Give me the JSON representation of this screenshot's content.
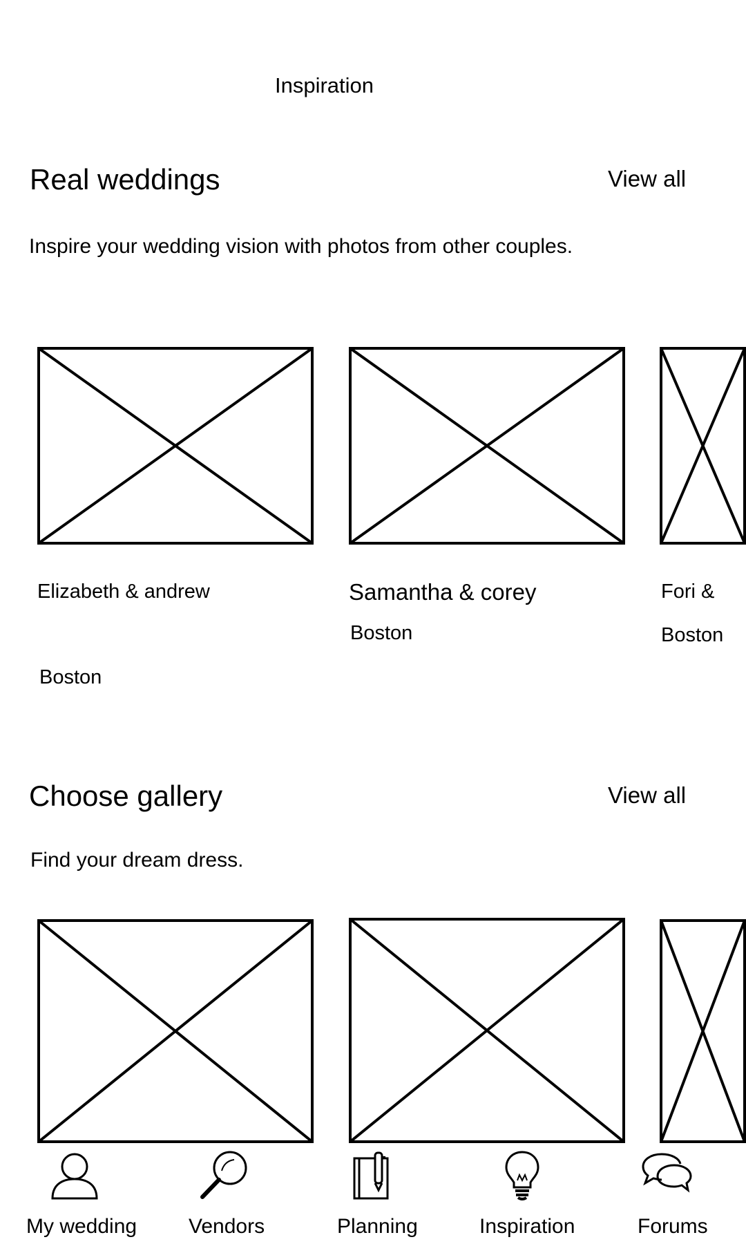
{
  "header": {
    "title": "Inspiration"
  },
  "real_weddings": {
    "title": "Real weddings",
    "view_all": "View all",
    "subtitle": "Inspire your wedding vision with photos from other couples.",
    "cards": [
      {
        "names": "Elizabeth & andrew",
        "location": "Boston"
      },
      {
        "names": "Samantha & corey",
        "location": "Boston"
      },
      {
        "names": "Fori &",
        "location": "Boston"
      }
    ]
  },
  "choose_gallery": {
    "title": "Choose gallery",
    "view_all": "View all",
    "subtitle": "Find your dream dress."
  },
  "bottom_nav": {
    "items": [
      {
        "label": "My wedding",
        "icon": "person-icon"
      },
      {
        "label": "Vendors",
        "icon": "magnifier-icon"
      },
      {
        "label": "Planning",
        "icon": "notebook-pen-icon"
      },
      {
        "label": "Inspiration",
        "icon": "lightbulb-icon"
      },
      {
        "label": "Forums",
        "icon": "chat-bubbles-icon"
      }
    ]
  }
}
